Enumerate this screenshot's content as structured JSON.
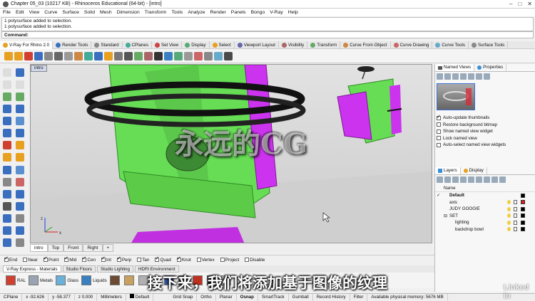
{
  "window": {
    "title": "Chapter 05_03 (10217 KB) - Rhinoceros Educational (64-bit) - [intro]",
    "min": "–",
    "max": "□",
    "close": "✕"
  },
  "menu": [
    "File",
    "Edit",
    "View",
    "Curve",
    "Surface",
    "Solid",
    "Mesh",
    "Dimension",
    "Transform",
    "Tools",
    "Analyze",
    "Render",
    "Panels",
    "Bongo",
    "V-Ray",
    "Help"
  ],
  "history": [
    "1 polysurface added to selection.",
    "1 polysurface added to selection."
  ],
  "command_label": "Command:",
  "toolbar_tabs": [
    {
      "label": "V-Ray For Rhino 2.0",
      "color": "#e8a020",
      "active": true
    },
    {
      "label": "Render Tools",
      "color": "#3a6fc0"
    },
    {
      "label": "Standard",
      "color": "#888"
    },
    {
      "label": "CPlanes",
      "color": "#4a9"
    },
    {
      "label": "Set View",
      "color": "#c44"
    },
    {
      "label": "Display",
      "color": "#5a7"
    },
    {
      "label": "Select",
      "color": "#e8a020"
    },
    {
      "label": "Viewport Layout",
      "color": "#66a"
    },
    {
      "label": "Visibility",
      "color": "#a66"
    },
    {
      "label": "Transform",
      "color": "#6a6"
    },
    {
      "label": "Curve From Object",
      "color": "#c84"
    },
    {
      "label": "Curve Drawing",
      "color": "#c66"
    },
    {
      "label": "Curve Tools",
      "color": "#6ac"
    },
    {
      "label": "Surface Tools",
      "color": "#888"
    }
  ],
  "viewport": {
    "title": "intro",
    "tabs": [
      "intro",
      "Top",
      "Front",
      "Right",
      "+"
    ],
    "axis_x": "x",
    "axis_z": "z"
  },
  "osnap": {
    "items": [
      {
        "label": "End",
        "checked": true
      },
      {
        "label": "Near",
        "checked": false
      },
      {
        "label": "Point",
        "checked": true
      },
      {
        "label": "Mid",
        "checked": true
      },
      {
        "label": "Cen",
        "checked": true
      },
      {
        "label": "Int",
        "checked": true
      },
      {
        "label": "Perp",
        "checked": true
      },
      {
        "label": "Tan",
        "checked": false
      },
      {
        "label": "Quad",
        "checked": true
      },
      {
        "label": "Knot",
        "checked": true
      },
      {
        "label": "Vertex",
        "checked": false
      },
      {
        "label": "Project",
        "checked": false
      },
      {
        "label": "Disable",
        "checked": false
      }
    ]
  },
  "bottom_tabs": [
    "V-Ray Express - Materials",
    "Studio Floors",
    "Studio Lighting",
    "HDRI Environment"
  ],
  "materials": [
    {
      "label": "RAL",
      "color": "#d04030"
    },
    {
      "label": "Metals",
      "color": "#9aa4b0"
    },
    {
      "label": "Glass",
      "color": "#6ab0d8"
    },
    {
      "label": "Liquids",
      "color": "#3a80c0"
    },
    {
      "label": "",
      "color": "#6a4a30"
    },
    {
      "label": "",
      "color": "#c8a060"
    },
    {
      "label": "Retail",
      "color": "#b0b0b0"
    },
    {
      "label": "",
      "color": "#3050a0"
    },
    {
      "label": "",
      "color": "#4a4a4a"
    },
    {
      "label": "",
      "color": "#c03020"
    },
    {
      "label": "",
      "color": "#2a2a2a"
    },
    {
      "label": "",
      "color": "#c0c0c0"
    }
  ],
  "status": {
    "cplane": "CPlane",
    "x": "x -92.626",
    "y": "y -58.377",
    "z": "z 0.000",
    "units": "Millimeters",
    "layer": "Default",
    "grid_snap": "Grid Snap",
    "ortho": "Ortho",
    "planar": "Planar",
    "osnap": "Osnap",
    "smarttrack": "SmartTrack",
    "gumball": "Gumball",
    "record_history": "Record History",
    "filter": "Filter",
    "memory": "Available physical memory: 5676 MB"
  },
  "named_views": {
    "tab1": "Named Views",
    "tab2": "Properties",
    "options": [
      {
        "label": "Auto-update thumbnails",
        "checked": true
      },
      {
        "label": "Restore background bitmap",
        "checked": false
      },
      {
        "label": "Show named view widget",
        "checked": false
      },
      {
        "label": "Lock named view",
        "checked": false
      },
      {
        "label": "Auto-select named view widgets",
        "checked": false
      }
    ]
  },
  "layers": {
    "tab1": "Layers",
    "tab2": "Display",
    "header": "Name",
    "rows": [
      {
        "name": "Default",
        "bold": true,
        "indent": 0,
        "color": "#000000",
        "current": true
      },
      {
        "name": "axis",
        "bold": false,
        "indent": 1,
        "color": "#e02020"
      },
      {
        "name": "JUDY GOOGIE",
        "bold": false,
        "indent": 1,
        "color": "#000000"
      },
      {
        "name": "SET",
        "bold": false,
        "indent": 1,
        "color": "#000000",
        "expand": "⊟"
      },
      {
        "name": "lighting",
        "bold": false,
        "indent": 2,
        "color": "#000000"
      },
      {
        "name": "backdrop bowl",
        "bold": false,
        "indent": 2,
        "color": "#000000"
      }
    ]
  },
  "overlay": {
    "watermark": "永远的CG",
    "subtitle": "接下来，我们将添加基于图像的纹理",
    "brand": "Linked in"
  }
}
